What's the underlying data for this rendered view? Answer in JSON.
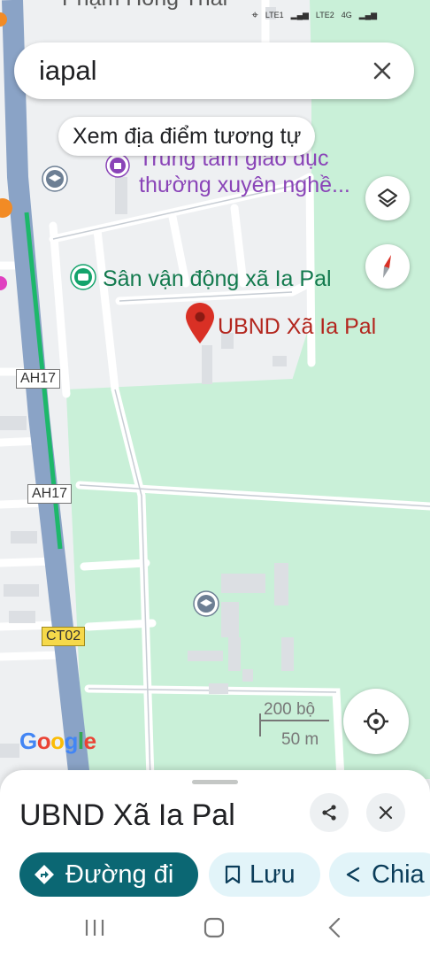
{
  "search": {
    "query": "iapal"
  },
  "similar_places_label": "Xem địa điểm tương tự",
  "map": {
    "labels": {
      "school_line1": "Trung tâm giáo dục",
      "school_line2": "thường xuyên nghề...",
      "stadium": "Sân vận động xã Ia Pal",
      "selected_place": "UBND Xã Ia Pal",
      "top_partial": "Phạm Hồng Thái"
    },
    "road_shields": [
      "AH17",
      "AH17",
      "CT02"
    ],
    "scale": {
      "top": "200 bộ",
      "bottom": "50 m"
    },
    "google_logo": "Google"
  },
  "status": {
    "sim1": "LTE1",
    "sim2": "LTE2",
    "net": "4G"
  },
  "sheet": {
    "title": "UBND Xã Ia Pal",
    "directions_label": "Đường đi",
    "save_label": "Lưu",
    "share_label": "Chia"
  },
  "colors": {
    "accent": "#0b6773",
    "pin": "#d93025",
    "park": "#c9f0d8",
    "road": "#8aa3c6"
  }
}
